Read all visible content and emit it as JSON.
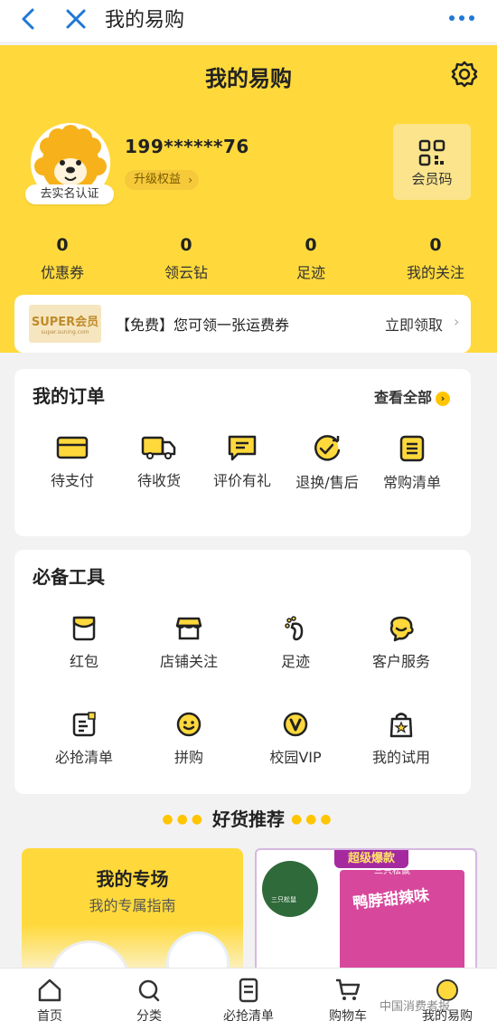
{
  "nav": {
    "title": "我的易购"
  },
  "header": {
    "title": "我的易购",
    "phone": "199******76",
    "upgrade_label": "升级权益",
    "realname_label": "去实名认证",
    "member_code_label": "会员码"
  },
  "stats": [
    {
      "value": "0",
      "label": "优惠券"
    },
    {
      "value": "0",
      "label": "领云钻"
    },
    {
      "value": "0",
      "label": "足迹"
    },
    {
      "value": "0",
      "label": "我的关注"
    }
  ],
  "promo": {
    "badge_title": "SUPER会员",
    "badge_sub": "super.suning.com",
    "text": "【免费】您可领一张运费券",
    "action": "立即领取"
  },
  "orders": {
    "title": "我的订单",
    "view_all": "查看全部",
    "items": [
      {
        "label": "待支付",
        "icon": "card-icon"
      },
      {
        "label": "待收货",
        "icon": "truck-icon"
      },
      {
        "label": "评价有礼",
        "icon": "comment-icon"
      },
      {
        "label": "退换/售后",
        "icon": "refund-icon"
      },
      {
        "label": "常购清单",
        "icon": "list-icon"
      }
    ]
  },
  "tools": {
    "title": "必备工具",
    "items": [
      {
        "label": "红包",
        "icon": "red-packet-icon"
      },
      {
        "label": "店铺关注",
        "icon": "store-icon"
      },
      {
        "label": "足迹",
        "icon": "footprint-icon"
      },
      {
        "label": "客户服务",
        "icon": "service-icon"
      },
      {
        "label": "必抢清单",
        "icon": "checklist-icon"
      },
      {
        "label": "拼购",
        "icon": "group-buy-icon"
      },
      {
        "label": "校园VIP",
        "icon": "vip-icon"
      },
      {
        "label": "我的试用",
        "icon": "trial-bag-icon"
      }
    ]
  },
  "recommend": {
    "title": "好货推荐",
    "special_title": "我的专场",
    "special_subtitle": "我的专属指南",
    "product_banner": "超级爆款",
    "product_text": "鸭脖甜辣味",
    "brand_label": "三只松鼠"
  },
  "tabbar": [
    {
      "label": "首页",
      "icon": "home-icon"
    },
    {
      "label": "分类",
      "icon": "search-icon"
    },
    {
      "label": "必抢清单",
      "icon": "list-icon"
    },
    {
      "label": "购物车",
      "icon": "cart-icon"
    },
    {
      "label": "我的易购",
      "icon": "profile-icon"
    }
  ],
  "watermark": "中国消费者报",
  "colors": {
    "brand_yellow": "#ffd93b",
    "accent": "#ffc500",
    "nav_blue": "#1e78d6"
  }
}
